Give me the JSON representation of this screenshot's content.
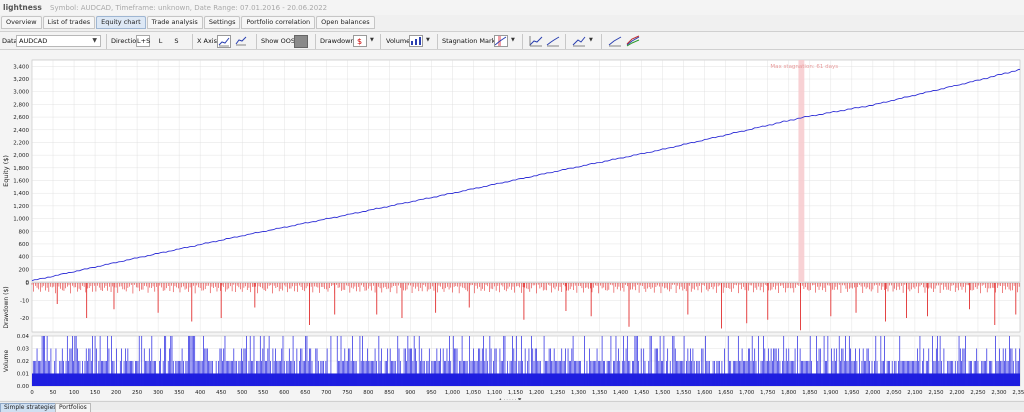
{
  "app": {
    "name": "lightness",
    "subtitle": "Symbol: AUDCAD, Timeframe: unknown, Date Range: 07.01.2016 - 20.06.2022"
  },
  "tabs": [
    {
      "label": "Overview",
      "active": false
    },
    {
      "label": "List of trades",
      "active": false
    },
    {
      "label": "Equity chart",
      "active": true
    },
    {
      "label": "Trade analysis",
      "active": false
    },
    {
      "label": "Settings",
      "active": false
    },
    {
      "label": "Portfolio correlation",
      "active": false
    },
    {
      "label": "Open balances",
      "active": false
    }
  ],
  "toolbar": {
    "data_label": "Data",
    "data_value": "AUDCAD",
    "direction_label": "Direction",
    "direction_options": [
      "L+S",
      "L",
      "S"
    ],
    "direction_selected": "L+S",
    "xaxis_label": "X Axis",
    "show_oos_label": "Show OOS",
    "drawdown_label": "Drawdown",
    "volume_label": "Volume",
    "stagnation_label": "Stagnation Marker"
  },
  "colors": {
    "equity_line": "#2f2fd6",
    "drawdown": "#e23030",
    "volume": "#1f1fe0",
    "stagnation": "#f7c9cc",
    "stagnation_text": "#e89a9a",
    "grid": "#dcdcdc"
  },
  "chart_data": [
    {
      "type": "line",
      "name": "equity",
      "ylabel": "Equity ($)",
      "ylim": [
        0,
        3500
      ],
      "yticks": [
        0,
        200,
        400,
        600,
        800,
        1000,
        1200,
        1400,
        1600,
        1800,
        2000,
        2200,
        2400,
        2600,
        2800,
        3000,
        3200,
        3400
      ],
      "x": [
        0,
        250,
        500,
        750,
        1000,
        1250,
        1500,
        1750,
        1830,
        2000,
        2250,
        2350
      ],
      "y": [
        20,
        380,
        730,
        1060,
        1400,
        1750,
        2090,
        2470,
        2590,
        2790,
        3180,
        3350
      ],
      "annotation": "Max stagnation: 61 days",
      "stagnation_range": [
        1823,
        1837
      ],
      "grid": true
    },
    {
      "type": "bar",
      "name": "drawdown",
      "ylabel": "Drawdown ($)",
      "ylim": [
        -28,
        0
      ],
      "yticks": [
        0,
        -10,
        -20
      ],
      "spikes": [
        {
          "x": 60,
          "y": -12
        },
        {
          "x": 130,
          "y": -20
        },
        {
          "x": 195,
          "y": -15
        },
        {
          "x": 300,
          "y": -17
        },
        {
          "x": 380,
          "y": -22
        },
        {
          "x": 450,
          "y": -20
        },
        {
          "x": 530,
          "y": -14
        },
        {
          "x": 660,
          "y": -24
        },
        {
          "x": 720,
          "y": -18
        },
        {
          "x": 820,
          "y": -18
        },
        {
          "x": 880,
          "y": -20
        },
        {
          "x": 960,
          "y": -17
        },
        {
          "x": 1040,
          "y": -14
        },
        {
          "x": 1170,
          "y": -21
        },
        {
          "x": 1270,
          "y": -16
        },
        {
          "x": 1330,
          "y": -19
        },
        {
          "x": 1420,
          "y": -25
        },
        {
          "x": 1560,
          "y": -18
        },
        {
          "x": 1640,
          "y": -26
        },
        {
          "x": 1700,
          "y": -23
        },
        {
          "x": 1750,
          "y": -21
        },
        {
          "x": 1828,
          "y": -27
        },
        {
          "x": 1900,
          "y": -19
        },
        {
          "x": 1960,
          "y": -17
        },
        {
          "x": 2030,
          "y": -22
        },
        {
          "x": 2080,
          "y": -20
        },
        {
          "x": 2130,
          "y": -19
        },
        {
          "x": 2230,
          "y": -15
        },
        {
          "x": 2290,
          "y": -24
        },
        {
          "x": 2340,
          "y": -18
        }
      ]
    },
    {
      "type": "bar",
      "name": "volume",
      "ylabel": "Volume",
      "ylim": [
        0,
        0.04
      ],
      "yticks": [
        0,
        0.01,
        0.02,
        0.03,
        0.04
      ],
      "levels": [
        0.01,
        0.02,
        0.03,
        0.04
      ],
      "xlim": [
        0,
        2350
      ],
      "xticks": [
        0,
        50,
        100,
        150,
        200,
        250,
        300,
        350,
        400,
        450,
        500,
        550,
        600,
        650,
        700,
        750,
        800,
        850,
        900,
        950,
        1000,
        1050,
        1100,
        1150,
        1200,
        1250,
        1300,
        1350,
        1400,
        1450,
        1500,
        1550,
        1600,
        1650,
        1700,
        1750,
        1800,
        1850,
        1900,
        1950,
        2000,
        2050,
        2100,
        2150,
        2200,
        2250,
        2300,
        2350
      ],
      "xtick_labels": [
        "0",
        "50",
        "100",
        "150",
        "200",
        "250",
        "300",
        "350",
        "400",
        "450",
        "500",
        "550",
        "600",
        "650",
        "700",
        "750",
        "800",
        "850",
        "900",
        "950",
        "1,000",
        "1,050",
        "1,100",
        "1,150",
        "1,200",
        "1,250",
        "1,300",
        "1,350",
        "1,400",
        "1,450",
        "1,500",
        "1,550",
        "1,600",
        "1,650",
        "1,700",
        "1,750",
        "1,800",
        "1,850",
        "1,900",
        "1,950",
        "2,000",
        "2,050",
        "2,100",
        "2,150",
        "2,200",
        "2,250",
        "2,300",
        "2,350"
      ]
    }
  ],
  "bottom_tabs": [
    {
      "label": "Simple strategies",
      "active": true
    },
    {
      "label": "Portfolios",
      "active": false
    }
  ]
}
